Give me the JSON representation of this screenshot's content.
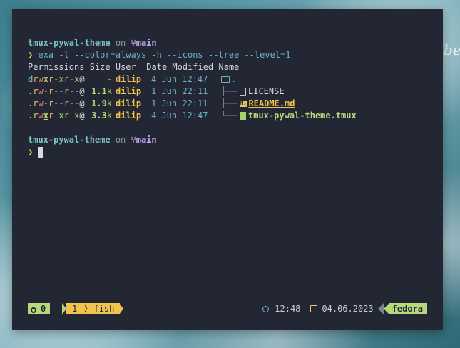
{
  "wallpaper": {
    "script_text": "be"
  },
  "prompt1": {
    "dir": "tmux-pywal-theme",
    "on": "on",
    "branch_icon": "git-branch-icon",
    "branch": "main",
    "symbol": "❯"
  },
  "command": "exa -l --color=always -h --icons --tree --level=1",
  "headers": {
    "permissions": "Permissions",
    "size": "Size",
    "user": "User",
    "date": "Date Modified",
    "name": "Name"
  },
  "rows": [
    {
      "perm_type": "d",
      "perm": [
        "r",
        "w",
        "x",
        "r",
        "-",
        "x",
        "r",
        "-",
        "x"
      ],
      "perm_suffix": "@",
      "size_num": "-",
      "size_unit": "",
      "user": "dilip",
      "date": "4 Jun 12:47",
      "tree": "",
      "icon": "folder-icon",
      "name": "."
    },
    {
      "perm_type": ".",
      "perm": [
        "r",
        "w",
        "-",
        "r",
        "-",
        "-",
        "r",
        "-",
        "-"
      ],
      "perm_suffix": "@",
      "size_num": "1.1",
      "size_unit": "k",
      "user": "dilip",
      "date": "1 Jun 22:11",
      "tree": "├──",
      "icon": "file-icon",
      "name": "LICENSE"
    },
    {
      "perm_type": ".",
      "perm": [
        "r",
        "w",
        "-",
        "r",
        "-",
        "-",
        "r",
        "-",
        "-"
      ],
      "perm_suffix": "@",
      "size_num": "1.9",
      "size_unit": "k",
      "user": "dilip",
      "date": "1 Jun 22:11",
      "tree": "├──",
      "icon": "markdown-icon",
      "name": "README.md"
    },
    {
      "perm_type": ".",
      "perm": [
        "r",
        "w",
        "x",
        "r",
        "-",
        "x",
        "r",
        "-",
        "x"
      ],
      "perm_suffix": "@",
      "size_num": "3.3",
      "size_unit": "k",
      "user": "dilip",
      "date": "4 Jun 12:47",
      "tree": "└──",
      "icon": "tmux-file-icon",
      "name": "tmux-pywal-theme.tmux"
    }
  ],
  "prompt2": {
    "dir": "tmux-pywal-theme",
    "on": "on",
    "branch": "main",
    "symbol": "❯"
  },
  "statusbar": {
    "session": "0",
    "window_index": "1",
    "window_name": "fish",
    "time": "12:48",
    "date": "04.06.2023",
    "host": "fedora"
  },
  "colors": {
    "bg": "#232734",
    "green": "#b6d77a",
    "yellow": "#f0c34d",
    "teal": "#7ac4c4"
  }
}
